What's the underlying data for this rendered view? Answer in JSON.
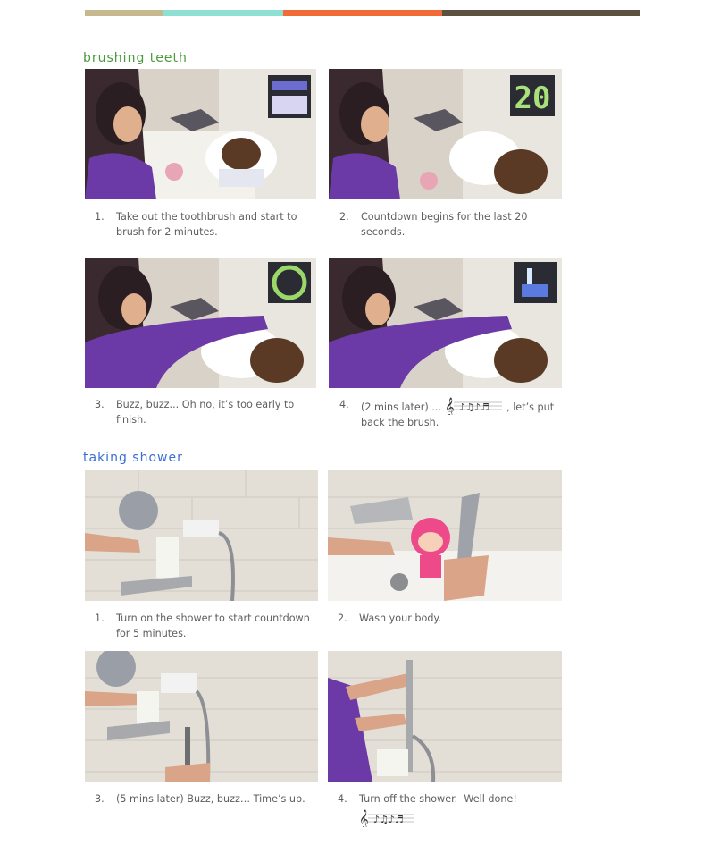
{
  "header": {
    "colors": [
      "#c7b98f",
      "#8ee0d2",
      "#f26a35",
      "#5c5041"
    ]
  },
  "brushing": {
    "title": "Brushing Teeth",
    "title_color": "#4a9a3c",
    "steps": [
      {
        "num": "1.",
        "text": "Take out the toothbrush and start to brush for 2 minutes.",
        "display": "matrix-animation"
      },
      {
        "num": "2.",
        "text": "Countdown begins for the last 20 seconds.",
        "display": "20"
      },
      {
        "num": "3.",
        "text": "Buzz, buzz... Oh no, it’s too early to finish.",
        "display": "matrix-animation"
      },
      {
        "num": "4.",
        "text_before": "(2 mins later) ...",
        "text_after": ", let’s put back the brush.",
        "display": "matrix-animation"
      }
    ]
  },
  "shower": {
    "title": "Taking Shower",
    "title_color": "#3a6fcf",
    "steps": [
      {
        "num": "1.",
        "text": "Turn on the shower to start countdown for 5 minutes."
      },
      {
        "num": "2.",
        "text": "Wash your body."
      },
      {
        "num": "3.",
        "text": "(5 mins later) Buzz, buzz… Time’s up."
      },
      {
        "num": "4.",
        "text": "Turn off the shower.  Well done!"
      }
    ]
  }
}
